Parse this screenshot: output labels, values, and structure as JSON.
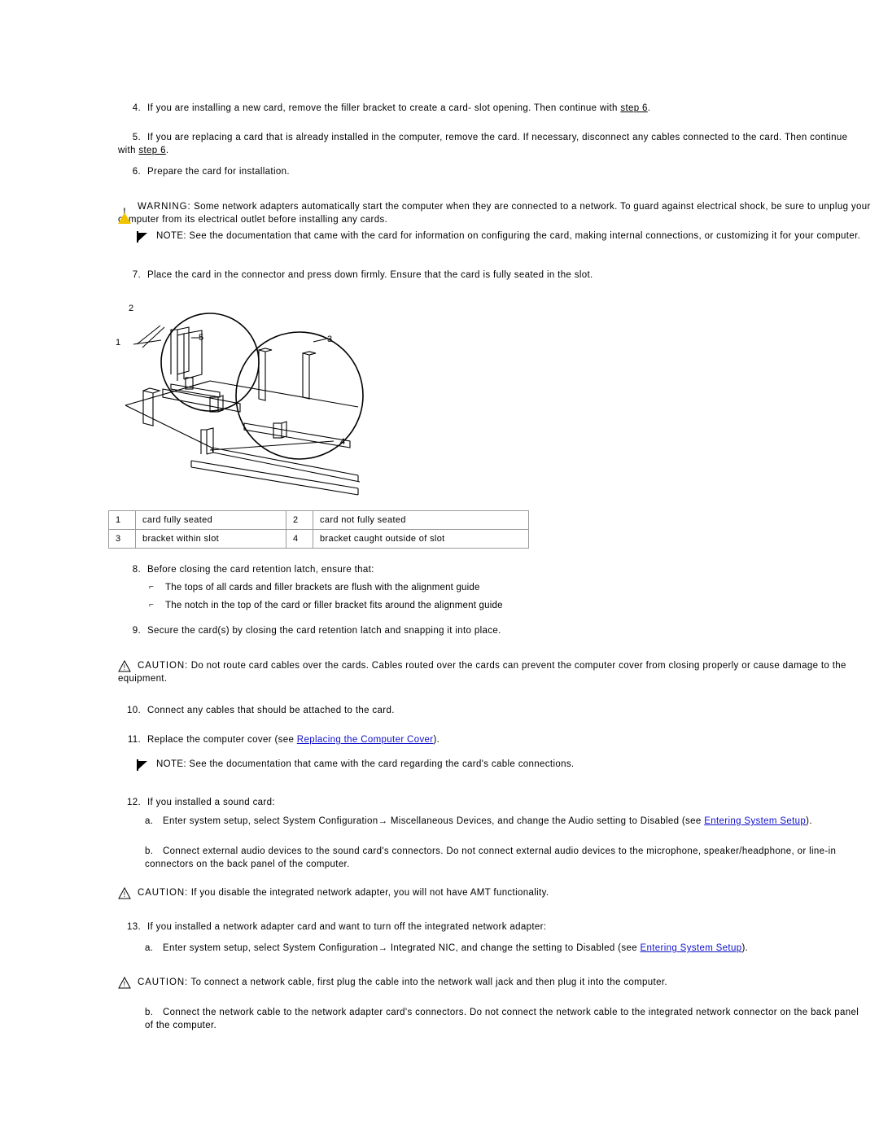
{
  "steps": [
    {
      "num": "4.",
      "parts": [
        {
          "t": "text",
          "v": "If you are installing a new card, remove the filler bracket to create a card- slot opening. Then continue with "
        },
        {
          "t": "ulink",
          "v": "step 6"
        },
        {
          "t": "text",
          "v": "."
        }
      ]
    },
    {
      "num": "5.",
      "parts": [
        {
          "t": "text",
          "v": "If you are replacing a card that is already installed in the computer, remove the card. If necessary, disconnect any cables connected to the card. Then continue with "
        },
        {
          "t": "ulink",
          "v": "step 6"
        },
        {
          "t": "text",
          "v": "."
        }
      ]
    },
    {
      "num": "6.",
      "parts": [
        {
          "t": "text",
          "v": "Prepare the card for installation."
        }
      ]
    },
    {
      "num": "7.",
      "parts": [
        {
          "t": "text",
          "v": "Place the card in the connector and press down firmly. Ensure that the card is fully seated in the slot."
        }
      ]
    },
    {
      "num": "8.",
      "parts": [
        {
          "t": "text",
          "v": "Before closing the card retention latch, ensure that:"
        }
      ]
    },
    {
      "num": "9.",
      "parts": [
        {
          "t": "text",
          "v": "Secure the card(s) by closing the card retention latch and snapping it into place."
        }
      ]
    },
    {
      "num": "10.",
      "parts": [
        {
          "t": "text",
          "v": "Connect any cables that should be attached to the card."
        }
      ]
    },
    {
      "num": "11.",
      "parts": [
        {
          "t": "text",
          "v": "Replace the computer cover (see "
        },
        {
          "t": "link",
          "v": "Replacing the Computer Cover"
        },
        {
          "t": "text",
          "v": ")."
        }
      ]
    },
    {
      "num": "12.",
      "parts": [
        {
          "t": "text",
          "v": "If you installed a sound card:"
        }
      ]
    },
    {
      "num": "13.",
      "parts": [
        {
          "t": "text",
          "v": "If you installed a network adapter card and want to turn off the integrated network adapter:"
        }
      ]
    }
  ],
  "notices": {
    "warning_network_adapters": {
      "keyword": "WARNING:",
      "text": " Some network adapters automatically start the computer when they are connected to a network. To guard against electrical shock, be sure to unplug your computer from its electrical outlet before installing any cards."
    },
    "note_documentation_card": {
      "keyword": "NOTE:",
      "text": " See the documentation that came with the card for information on configuring the card, making internal connections, or customizing it for your computer."
    },
    "caution_card_cables": {
      "keyword": "CAUTION:",
      "text": " Do not route card cables over the cards. Cables routed over the cards can prevent the computer cover from closing properly or cause damage to the equipment."
    },
    "note_cable_connections": {
      "keyword": "NOTE:",
      "text": " See the documentation that came with the card regarding the card's cable connections."
    },
    "caution_amt": {
      "keyword": "CAUTION:",
      "text": " If you disable the integrated network adapter, you will not have AMT functionality."
    },
    "caution_network_cable": {
      "keyword": "CAUTION:",
      "text": " To connect a network cable, first plug the cable into the network wall jack and then plug it into the computer."
    }
  },
  "bullets": [
    "The tops of all cards and filler brackets are flush with the alignment guide",
    "The notch in the top of the card or filler bracket fits around the alignment guide"
  ],
  "sub_steps": {
    "sound_a": [
      {
        "t": "text",
        "v": "Enter system setup, select System Configuration"
      },
      {
        "t": "arrow",
        "v": "→"
      },
      {
        "t": "text",
        "v": " Miscellaneous Devices, and change the Audio setting to Disabled (see "
      },
      {
        "t": "link",
        "v": "Entering System Setup"
      },
      {
        "t": "text",
        "v": ")."
      }
    ],
    "sound_b": [
      {
        "t": "text",
        "v": "Connect external audio devices to the sound card's connectors. Do not connect external audio devices to the microphone, speaker/headphone, or line-in connectors on the back panel of the computer."
      }
    ],
    "network_a": [
      {
        "t": "text",
        "v": "Enter system setup, select System Configuration"
      },
      {
        "t": "arrow",
        "v": "→"
      },
      {
        "t": "text",
        "v": " Integrated NIC, and change the setting to Disabled (see "
      },
      {
        "t": "link",
        "v": "Entering System Setup"
      },
      {
        "t": "text",
        "v": ")."
      }
    ],
    "network_b": [
      {
        "t": "text",
        "v": "Connect the network cable to the network adapter card's connectors. Do not connect the network cable to the integrated network connector on the back panel of the computer."
      }
    ]
  },
  "sub_labels": {
    "a": "a.",
    "b": "b."
  },
  "legend_table": {
    "rows": [
      [
        {
          "num": "1",
          "text": "card fully seated"
        },
        {
          "num": "2",
          "text": "card not fully seated"
        }
      ],
      [
        {
          "num": "3",
          "text": "bracket within slot"
        },
        {
          "num": "4",
          "text": "bracket caught outside of slot"
        }
      ]
    ]
  },
  "figure": {
    "callouts": [
      "1",
      "2",
      "3",
      "4",
      "5"
    ],
    "alt": "Illustration of a card being seated into an expansion slot with detail callouts"
  },
  "colors": {
    "link": "#1111cc",
    "warning_icon": "#f2c400",
    "table_border": "#9a9a9a",
    "text": "#000000"
  }
}
